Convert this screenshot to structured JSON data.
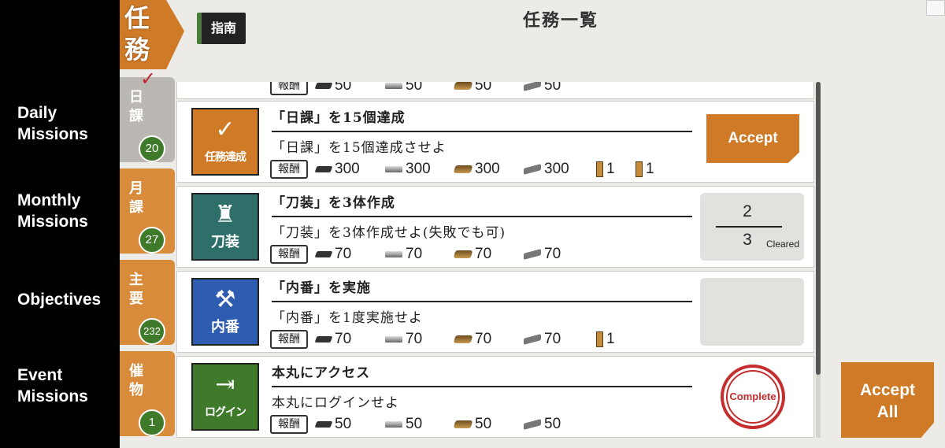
{
  "legend": {
    "daily": "Daily\nMissions",
    "monthly": "Monthly\nMissions",
    "objectives": "Objectives",
    "event": "Event\nMissions"
  },
  "header": {
    "banner_line1": "任",
    "banner_line2": "務",
    "guide": "指南",
    "title": "任務一覧"
  },
  "tabs": [
    {
      "label": "日課",
      "count": "20"
    },
    {
      "label": "月課",
      "count": "27"
    },
    {
      "label": "主要",
      "count": "232"
    },
    {
      "label": "催物",
      "count": "1"
    }
  ],
  "reward_label": "報酬",
  "partial_row": {
    "rewards": [
      "50",
      "50",
      "50",
      "50"
    ]
  },
  "missions": [
    {
      "icon_caption": "任務達成",
      "icon_color": "#cf7a26",
      "title": "「日課」を15個達成",
      "desc": "「日課」を15個達成させよ",
      "rewards": {
        "charcoal": "300",
        "steel": "300",
        "coolant": "300",
        "whetstone": "300",
        "token1": "1",
        "token2": "1"
      },
      "status": "Accept"
    },
    {
      "icon_caption": "刀装",
      "icon_color": "#2f6f6a",
      "title": "「刀装」を3体作成",
      "desc": "「刀装」を3体作成せよ(失敗でも可)",
      "rewards": {
        "charcoal": "70",
        "steel": "70",
        "coolant": "70",
        "whetstone": "70"
      },
      "progress": {
        "current": "2",
        "total": "3",
        "note": "Cleared"
      }
    },
    {
      "icon_caption": "内番",
      "icon_color": "#2d5cb0",
      "title": "「内番」を実施",
      "desc": "「内番」を1度実施せよ",
      "rewards": {
        "charcoal": "70",
        "steel": "70",
        "coolant": "70",
        "whetstone": "70",
        "token1": "1"
      }
    },
    {
      "icon_caption": "ログイン",
      "icon_color": "#3e7a2a",
      "title": "本丸にアクセス",
      "desc": "本丸にログインせよ",
      "rewards": {
        "charcoal": "50",
        "steel": "50",
        "coolant": "50",
        "whetstone": "50"
      },
      "status": "Complete"
    }
  ],
  "accept_all": "Accept\nAll"
}
